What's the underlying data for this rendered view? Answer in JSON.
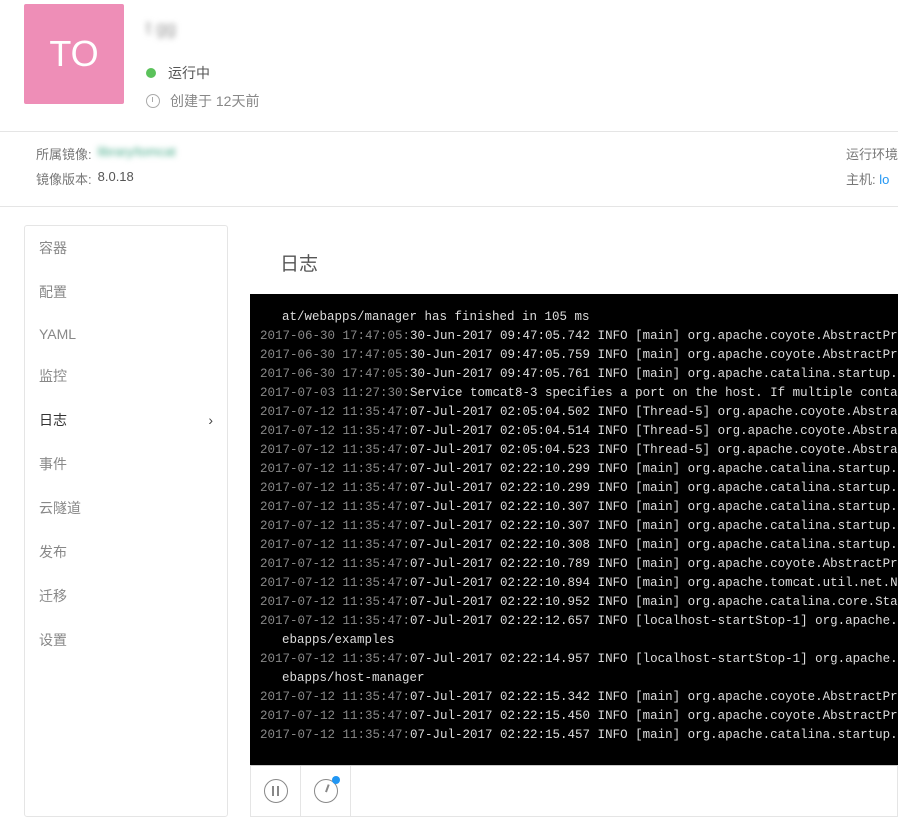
{
  "header": {
    "avatar_text": "TO",
    "app_name": "t         gg",
    "status_text": "运行中",
    "created_text": "创建于 12天前"
  },
  "meta": {
    "image_label": "所属镜像:",
    "image_value": "        library/tomcat",
    "version_label": "镜像版本:",
    "version_value": "8.0.18",
    "env_label": "运行环境",
    "host_label": "主机:",
    "host_value": "lo"
  },
  "sidebar": {
    "items": [
      {
        "label": "容器"
      },
      {
        "label": "配置"
      },
      {
        "label": "YAML"
      },
      {
        "label": "监控"
      },
      {
        "label": "日志"
      },
      {
        "label": "事件"
      },
      {
        "label": "云隧道"
      },
      {
        "label": "发布"
      },
      {
        "label": "迁移"
      },
      {
        "label": "设置"
      }
    ],
    "active_index": 4
  },
  "panel": {
    "title": "日志"
  },
  "logs": [
    {
      "ts": "",
      "msg": "     at/webapps/manager has finished in 105 ms",
      "cont": true
    },
    {
      "ts": "2017-06-30 17:47:05:",
      "msg": "30-Jun-2017 09:47:05.742 INFO [main] org.apache.coyote.AbstractPr"
    },
    {
      "ts": "2017-06-30 17:47:05:",
      "msg": "30-Jun-2017 09:47:05.759 INFO [main] org.apache.coyote.AbstractPr"
    },
    {
      "ts": "2017-06-30 17:47:05:",
      "msg": "30-Jun-2017 09:47:05.761 INFO [main] org.apache.catalina.startup."
    },
    {
      "ts": "2017-07-03 11:27:30:",
      "msg": "Service tomcat8-3 specifies a port on the host. If multiple conta"
    },
    {
      "ts": "2017-07-12 11:35:47:",
      "msg": "07-Jul-2017 02:05:04.502 INFO [Thread-5] org.apache.coyote.Abstra"
    },
    {
      "ts": "2017-07-12 11:35:47:",
      "msg": "07-Jul-2017 02:05:04.514 INFO [Thread-5] org.apache.coyote.Abstra"
    },
    {
      "ts": "2017-07-12 11:35:47:",
      "msg": "07-Jul-2017 02:05:04.523 INFO [Thread-5] org.apache.coyote.Abstra"
    },
    {
      "ts": "2017-07-12 11:35:47:",
      "msg": "07-Jul-2017 02:22:10.299 INFO [main] org.apache.catalina.startup."
    },
    {
      "ts": "2017-07-12 11:35:47:",
      "msg": "07-Jul-2017 02:22:10.299 INFO [main] org.apache.catalina.startup."
    },
    {
      "ts": "2017-07-12 11:35:47:",
      "msg": "07-Jul-2017 02:22:10.307 INFO [main] org.apache.catalina.startup."
    },
    {
      "ts": "2017-07-12 11:35:47:",
      "msg": "07-Jul-2017 02:22:10.307 INFO [main] org.apache.catalina.startup."
    },
    {
      "ts": "2017-07-12 11:35:47:",
      "msg": "07-Jul-2017 02:22:10.308 INFO [main] org.apache.catalina.startup."
    },
    {
      "ts": "2017-07-12 11:35:47:",
      "msg": "07-Jul-2017 02:22:10.789 INFO [main] org.apache.coyote.AbstractPr"
    },
    {
      "ts": "2017-07-12 11:35:47:",
      "msg": "07-Jul-2017 02:22:10.894 INFO [main] org.apache.tomcat.util.net.N"
    },
    {
      "ts": "2017-07-12 11:35:47:",
      "msg": "07-Jul-2017 02:22:10.952 INFO [main] org.apache.catalina.core.Sta"
    },
    {
      "ts": "2017-07-12 11:35:47:",
      "msg": "07-Jul-2017 02:22:12.657 INFO [localhost-startStop-1] org.apache."
    },
    {
      "ts": "",
      "msg": "ebapps/examples",
      "cont": true
    },
    {
      "ts": "2017-07-12 11:35:47:",
      "msg": "07-Jul-2017 02:22:14.957 INFO [localhost-startStop-1] org.apache."
    },
    {
      "ts": "",
      "msg": "ebapps/host-manager",
      "cont": true
    },
    {
      "ts": "2017-07-12 11:35:47:",
      "msg": "07-Jul-2017 02:22:15.342 INFO [main] org.apache.coyote.AbstractPr"
    },
    {
      "ts": "2017-07-12 11:35:47:",
      "msg": "07-Jul-2017 02:22:15.450 INFO [main] org.apache.coyote.AbstractPr"
    },
    {
      "ts": "2017-07-12 11:35:47:",
      "msg": "07-Jul-2017 02:22:15.457 INFO [main] org.apache.catalina.startup."
    }
  ]
}
